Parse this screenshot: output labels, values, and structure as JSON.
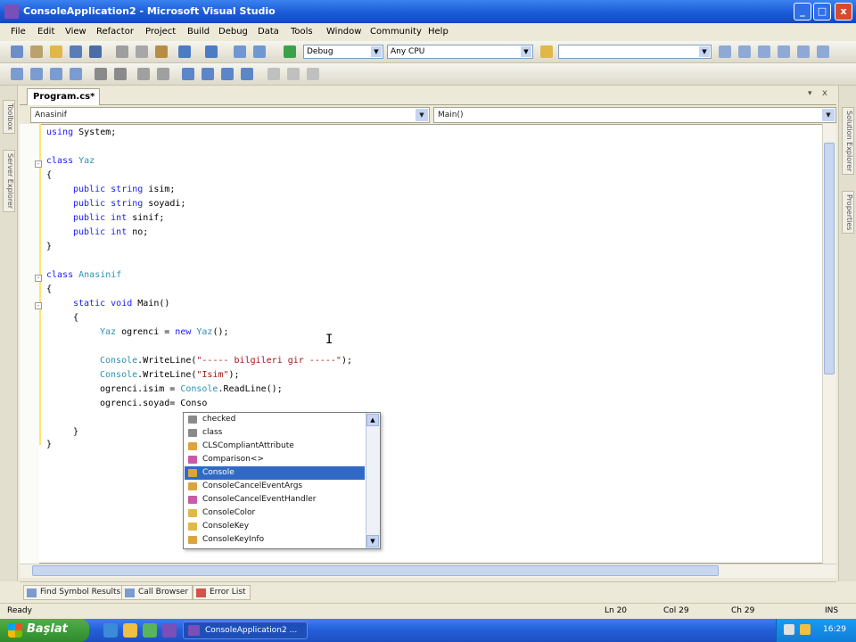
{
  "window": {
    "title": "ConsoleApplication2 - Microsoft Visual Studio",
    "controls": [
      "_",
      "□",
      "x"
    ]
  },
  "menu": [
    "File",
    "Edit",
    "View",
    "Refactor",
    "Project",
    "Build",
    "Debug",
    "Data",
    "Tools",
    "Window",
    "Community",
    "Help"
  ],
  "toolbar": {
    "config": "Debug",
    "platform": "Any CPU"
  },
  "editor": {
    "tab_label": "Program.cs*",
    "class_combo": "Anasinif",
    "member_combo": "Main()",
    "lines": [
      [
        "using System;"
      ],
      [
        "class Yaz"
      ],
      [
        "{"
      ],
      [
        "public string isim;"
      ],
      [
        "public string soyadi;"
      ],
      [
        "public int sinif;"
      ],
      [
        "public int no;"
      ],
      [
        "}"
      ],
      [
        "class Anasinif"
      ],
      [
        "{"
      ],
      [
        "static void Main()"
      ],
      [
        "{"
      ],
      [
        "Yaz ogrenci = new Yaz();"
      ],
      [
        "Console.WriteLine(\"----- bilgileri gir -----\");"
      ],
      [
        "Console.WriteLine(\"Isim\");"
      ],
      [
        "ogrenci.isim = Console.ReadLine();"
      ],
      [
        "ogrenci.soyad= Conso"
      ],
      [
        "}"
      ],
      [
        "}"
      ]
    ]
  },
  "intellisense": {
    "items": [
      "checked",
      "class",
      "CLSCompliantAttribute",
      "Comparison<>",
      "Console",
      "ConsoleCancelEventArgs",
      "ConsoleCancelEventHandler",
      "ConsoleColor",
      "ConsoleKey",
      "ConsoleKeyInfo"
    ],
    "selected_index": 4
  },
  "side_tabs": {
    "left": [
      "Toolbox",
      "Server Explorer"
    ],
    "right": [
      "Solution Explorer",
      "Properties"
    ]
  },
  "tool_tabs": [
    "Find Symbol Results",
    "Call Browser",
    "Error List"
  ],
  "status": {
    "text": "Ready",
    "ln": "Ln 20",
    "col": "Col 29",
    "ch": "Ch 29",
    "mode": "INS"
  },
  "taskbar": {
    "start_label": "Başlat",
    "task_label": "ConsoleApplication2 ...",
    "clock": "16:29"
  }
}
